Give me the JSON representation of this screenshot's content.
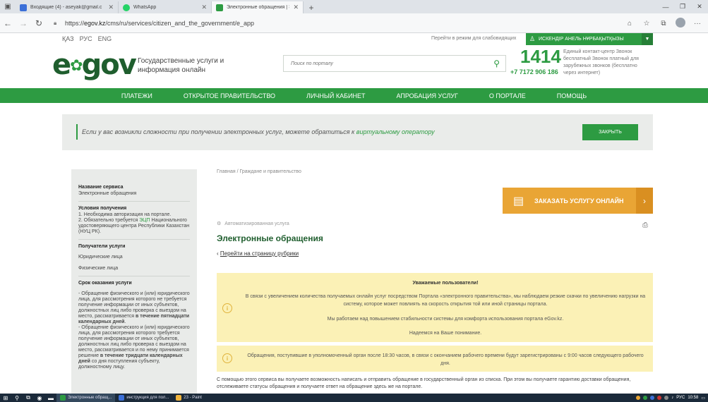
{
  "browser": {
    "tabs": [
      {
        "label": "Входящие (4) - aseyak@gmail.c",
        "color": "#3b6fd8",
        "active": false
      },
      {
        "label": "WhatsApp",
        "color": "#25d366",
        "active": false
      },
      {
        "label": "Электронные обращения | Элек",
        "color": "#2d9b42",
        "active": true
      }
    ],
    "url_prefix": "https://",
    "url_domain": "egov.kz",
    "url_path": "/cms/ru/services/citizen_and_the_government/e_app"
  },
  "site": {
    "langs": [
      "ҚАЗ",
      "РУС",
      "ENG"
    ],
    "visually_impaired": "Перейти в режим для слабовидящих",
    "user_name": "ИСКЕНДІР АНЕЛЬ НҰРБАҚЫТҚЫЗЫ",
    "logo": "egov",
    "tagline": "Государственные услуги и информация онлайн",
    "search_placeholder": "Поиск по порталу",
    "contact_number": "1414",
    "contact_number2": "+7 7172 906 186",
    "contact_info": "Единый контакт-центр Звонок бесплатный Звонок платный для зарубежных звонков (бесплатно через интернет)",
    "menu": [
      "ПЛАТЕЖИ",
      "ОТКРЫТОЕ ПРАВИТЕЛЬСТВО",
      "ЛИЧНЫЙ КАБИНЕТ",
      "АПРОБАЦИЯ УСЛУГ",
      "О ПОРТАЛЕ",
      "ПОМОЩЬ"
    ]
  },
  "notice": {
    "text": "Если у вас возникли сложности при получении электронных услуг, можете обратиться к ",
    "link": "виртуальному оператору",
    "close": "ЗАКРЫТЬ"
  },
  "sidebar": {
    "service_h": "Название сервиса",
    "service_v": "Электронные обращения",
    "cond_h": "Условия получения",
    "cond_1": "1. Необходима авторизация на портале.",
    "cond_2a": "2. Обязательно требуется ",
    "cond_2_link": "ЭЦП",
    "cond_2b": " Национального удостоверяющего центра Республики Казахстан (НУЦ РК).",
    "recip_h": "Получатели услуги",
    "recip_1": "Юридические лица",
    "recip_2": "Физические лица",
    "term_h": "Срок оказания услуги",
    "term_1": "- Обращение физического и (или) юридического лица, для рассмотрения которого не требуется получение информации от иных субъектов, должностных лиц либо проверка с выездом на место, рассматривается ",
    "term_1b": "в течение пятнадцати календарных дней",
    "term_2": "- Обращение физического и (или) юридического лица, для рассмотрения которого требуется получение информации от иных субъектов, должностных лиц либо проверка с выездом на место, рассматривается и по нему принимается решение ",
    "term_2b": "в течение тридцати календарных дней",
    "term_2c": " со дня поступления субъекту, должностному лицу."
  },
  "main": {
    "breadcrumb": "Главная / Граждане и правительство",
    "order_button": "ЗАКАЗАТЬ УСЛУГУ ОНЛАЙН",
    "auto_label": "Автоматизированная услуга",
    "title": "Электронные обращения",
    "back_link": "Перейти на страницу рубрики",
    "warn_h": "Уважаемые пользователи!",
    "warn_p1": "В связи с увеличением количества получаемых онлайн услуг посредством Портала «электронного правительства», мы наблюдаем резкие скачки по увеличению нагрузки на систему, которое может повлиять на скорость открытия той или иной страницы портала.",
    "warn_p2": "Мы работаем над повышением стабильности системы для комфорта использования портала eGov.kz.",
    "warn_p3": "Надеемся на Ваше понимание.",
    "warn2": "Обращения, поступившие в уполномоченный орган после 18:30 часов, в связи с окончанием рабочего времени будут зарегистрированы с 9:00 часов следующего рабочего дня.",
    "desc": "С помощью этого сервиса вы получаете возможность написать и отправить обращение в государственный орган из списка. При этом вы получаете гарантию доставки обращения, отслеживаете статусы обращения и получаете ответ на обращение здесь же на портале."
  },
  "taskbar": {
    "apps": [
      {
        "label": "Электронные обращ...",
        "color": "#2d9b42",
        "active": true
      },
      {
        "label": "инструкция для пол...",
        "color": "#3b6fd8",
        "active": false
      },
      {
        "label": "23 - Paint",
        "color": "#f0b43c",
        "active": false
      }
    ],
    "lang": "РУС",
    "time": "10:58"
  },
  "colors": {
    "green": "#2d9b42",
    "dark_green": "#1f5e2e",
    "orange": "#e9a535",
    "warn_bg": "#fbf1b6"
  }
}
